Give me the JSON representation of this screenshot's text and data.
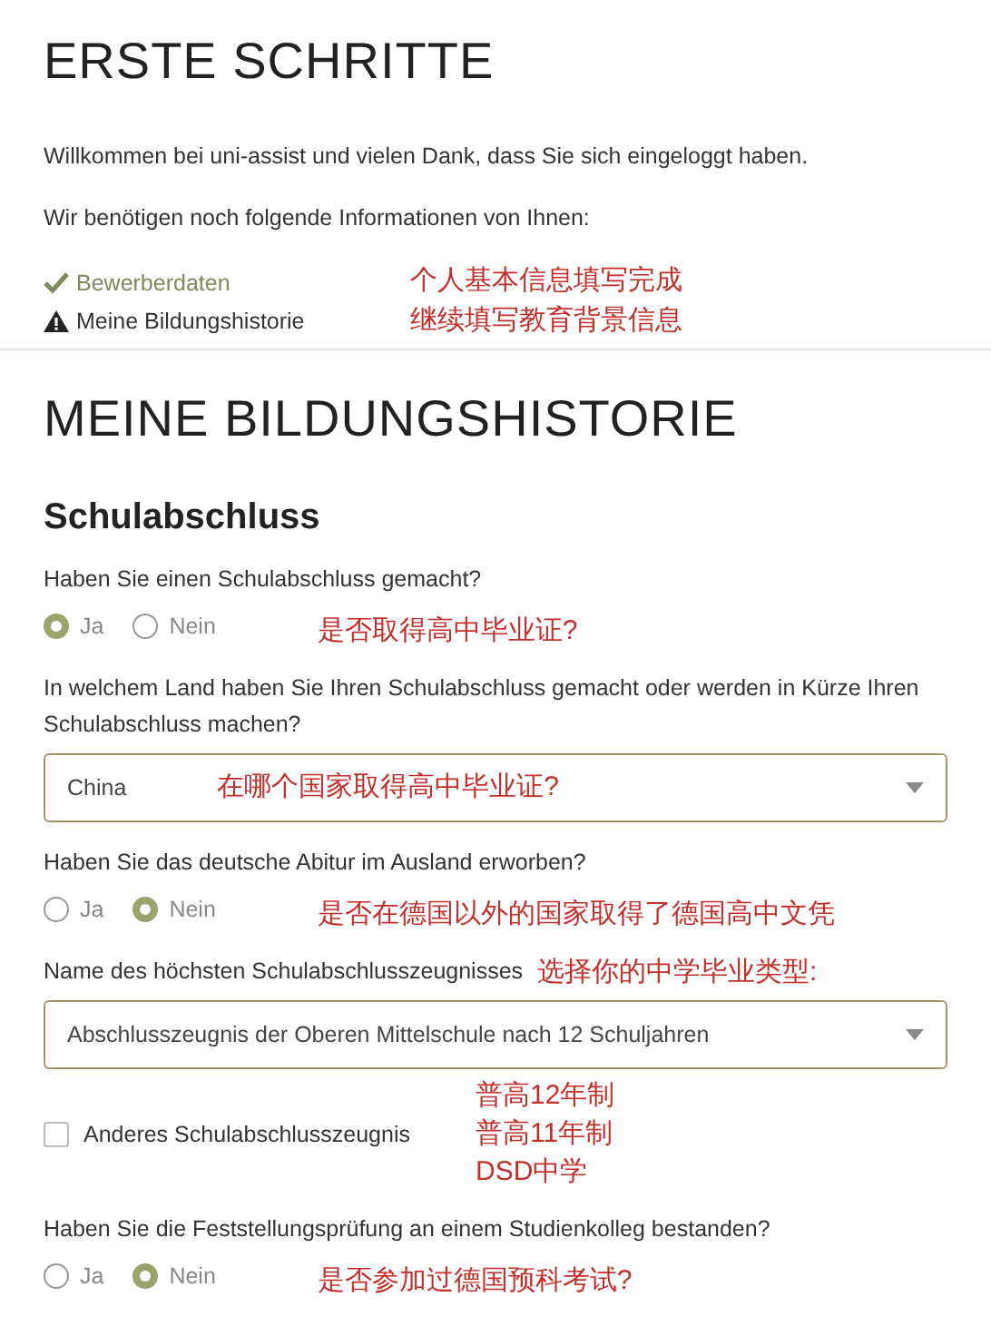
{
  "page_title": "ERSTE SCHRITTE",
  "intro": [
    "Willkommen bei uni-assist und vielen Dank, dass Sie sich eingeloggt haben.",
    "Wir benötigen noch folgende Informationen von Ihnen:"
  ],
  "steps": [
    {
      "label": "Bewerberdaten",
      "kind": "done"
    },
    {
      "label": "Meine Bildungshistorie",
      "kind": "warning"
    }
  ],
  "step_notes": [
    "个人基本信息填写完成",
    "继续填写教育背景信息"
  ],
  "section_title": "MEINE BILDUNGSHISTORIE",
  "subsection_title": "Schulabschluss",
  "questions": [
    {
      "kind": "radio",
      "label": "Haben Sie einen Schulabschluss gemacht?",
      "options": [
        {
          "label": "Ja",
          "selected": true
        },
        {
          "label": "Nein",
          "selected": false
        }
      ],
      "notes": [
        "是否取得高中毕业证?"
      ]
    },
    {
      "kind": "select",
      "label": "In welchem Land haben Sie Ihren Schulabschluss gemacht oder werden in Kürze Ihren Schulabschluss machen?",
      "value": "China",
      "notes": [
        "在哪个国家取得高中毕业证?"
      ]
    },
    {
      "kind": "radio",
      "label": "Haben Sie das deutsche Abitur im Ausland erworben?",
      "options": [
        {
          "label": "Ja",
          "selected": false
        },
        {
          "label": "Nein",
          "selected": true
        }
      ],
      "notes": [
        "是否在德国以外的国家取得了德国高中文凭"
      ]
    },
    {
      "kind": "select",
      "label": "Name des höchsten Schulabschlusszeugnisses",
      "value": "Abschlusszeugnis der Oberen Mittelschule nach 12 Schuljahren",
      "label_notes": [
        "选择你的中学毕业类型:"
      ]
    },
    {
      "kind": "checkbox",
      "label": "Anderes Schulabschlusszeugnis",
      "checked": false,
      "notes": [
        "普高12年制",
        "普高11年制",
        "DSD中学"
      ]
    },
    {
      "kind": "radio",
      "label": "Haben Sie die Feststellungsprüfung an einem Studienkolleg bestanden?",
      "options": [
        {
          "label": "Ja",
          "selected": false
        },
        {
          "label": "Nein",
          "selected": true
        }
      ],
      "notes": [
        "是否参加过德国预科考试?"
      ]
    }
  ]
}
